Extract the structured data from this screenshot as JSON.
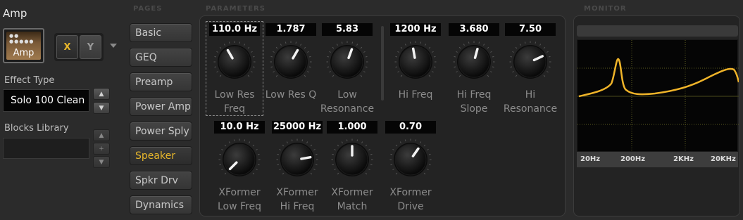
{
  "block": {
    "title": "Amp",
    "thumb_label": "Amp",
    "thumb_dots": "●● ●●●●●",
    "x_label": "X",
    "y_label": "Y"
  },
  "effect_type": {
    "label": "Effect Type",
    "value": "Solo 100 Clean",
    "up": "▲",
    "down": "▼"
  },
  "blocks_library": {
    "label": "Blocks Library",
    "up": "▲",
    "add": "+",
    "down": "▼"
  },
  "headers": {
    "pages": "PAGES",
    "parameters": "PARAMETERS",
    "monitor": "MONITOR"
  },
  "pages": [
    {
      "label": "Basic",
      "active": false
    },
    {
      "label": "GEQ",
      "active": false
    },
    {
      "label": "Preamp",
      "active": false
    },
    {
      "label": "Power Amp",
      "active": false
    },
    {
      "label": "Power Sply",
      "active": false
    },
    {
      "label": "Speaker",
      "active": true
    },
    {
      "label": "Spkr Drv",
      "active": false
    },
    {
      "label": "Dynamics",
      "active": false
    }
  ],
  "parameters": [
    {
      "value": "110.0 Hz",
      "label1": "Low Res",
      "label2": "Freq",
      "angle": -30
    },
    {
      "value": "1.787",
      "label1": "Low Res Q",
      "label2": "",
      "angle": 30
    },
    {
      "value": "5.83",
      "label1": "Low",
      "label2": "Resonance",
      "angle": 20
    },
    {
      "value": "1200 Hz",
      "label1": "Hi Freq",
      "label2": "",
      "angle": -10
    },
    {
      "value": "3.680",
      "label1": "Hi Freq",
      "label2": "Slope",
      "angle": 15
    },
    {
      "value": "7.50",
      "label1": "Hi",
      "label2": "Resonance",
      "angle": 65
    },
    {
      "value": "10.0 Hz",
      "label1": "XFormer",
      "label2": "Low Freq",
      "angle": -135
    },
    {
      "value": "25000 Hz",
      "label1": "XFormer",
      "label2": "Hi Freq",
      "angle": 80
    },
    {
      "value": "1.000",
      "label1": "XFormer",
      "label2": "Match",
      "angle": 0
    },
    {
      "value": "0.70",
      "label1": "XFormer",
      "label2": "Drive",
      "angle": 35
    }
  ],
  "monitor": {
    "freq_labels": [
      "20Hz",
      "200Hz",
      "2KHz",
      "20KHz"
    ],
    "curve_color": "#f0b429"
  },
  "colors": {
    "accent": "#e7b62b",
    "background": "#2b2b2b"
  }
}
